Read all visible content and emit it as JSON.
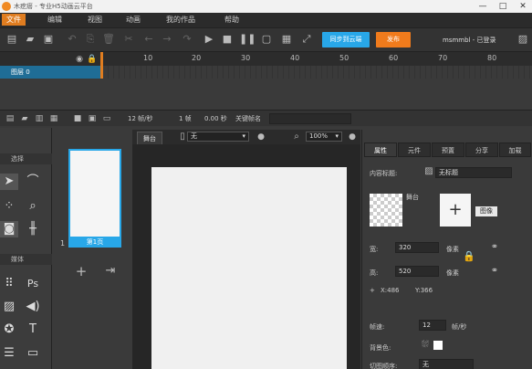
{
  "titlebar": {
    "title": "木疙瘩 - 专业H5动画云平台",
    "minimize": "—",
    "maximize": "□",
    "close": "✕"
  },
  "menu": {
    "items": [
      "文件",
      "编辑",
      "视图",
      "动画",
      "我的作品",
      "帮助"
    ]
  },
  "toolbar": {
    "sync_label": "同步到云端",
    "publish_label": "发布",
    "username": "msmmbl - 已登录"
  },
  "timeline": {
    "ticks": [
      "10",
      "20",
      "30",
      "40",
      "50",
      "60",
      "70",
      "80"
    ],
    "layer_name": "图层 0"
  },
  "timeline_footer": {
    "fps": "12 帧/秒",
    "frame": "1 帧",
    "time": "0.00 秒",
    "keyframe_label": "关键帧名"
  },
  "tools": {
    "section1": "选择",
    "section2": "媒体"
  },
  "pages": {
    "page_number": "1",
    "page_label": "第1页"
  },
  "canvas": {
    "tab_label": "舞台",
    "device_select": "无",
    "zoom_select": "100%"
  },
  "properties": {
    "tabs": [
      "属性",
      "元件",
      "预置",
      "分享",
      "加载"
    ],
    "content_title_label": "内容标题:",
    "content_title_value": "无标题",
    "stage_label": "舞台",
    "image_tag": "图像",
    "width_label": "宽:",
    "width_value": "320",
    "width_unit": "像素",
    "height_label": "高:",
    "height_value": "520",
    "height_unit": "像素",
    "x_readout": "X:486",
    "y_readout": "Y:366",
    "fps_label": "帧速:",
    "fps_value": "12",
    "fps_unit": "帧/秒",
    "bg_label": "背景色:",
    "loop_label": "切图顺序:",
    "loop_value": "无"
  }
}
